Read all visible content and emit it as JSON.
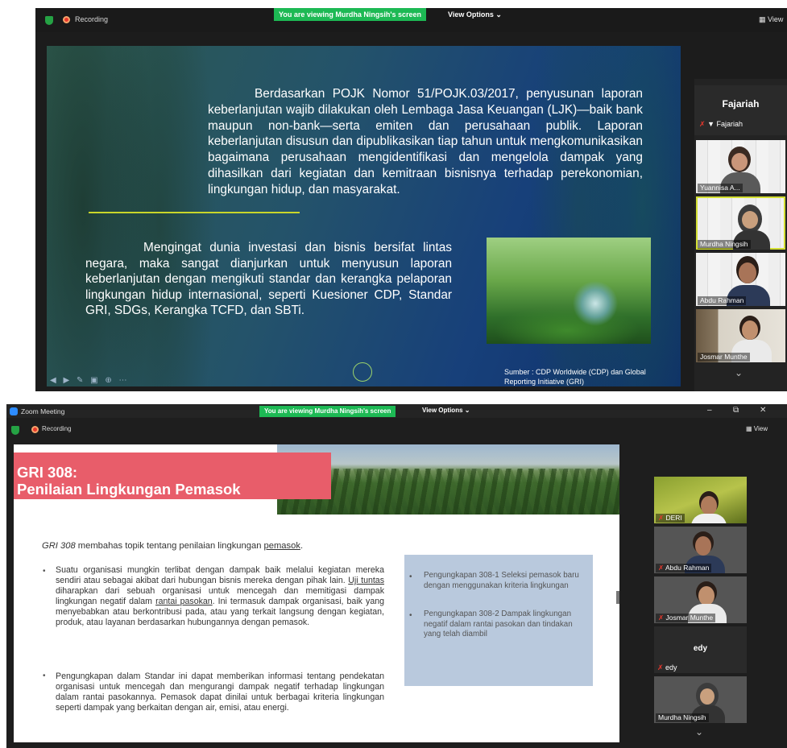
{
  "screen1": {
    "topbar": {
      "recording_label": "Recording",
      "banner": "You are viewing Murdha Ningsih's screen",
      "view_options": "View Options ⌄",
      "view_label": "View"
    },
    "slide": {
      "paragraph1": "Berdasarkan POJK Nomor 51/POJK.03/2017, penyusunan laporan keberlanjutan wajib dilakukan oleh Lembaga Jasa Keuangan (LJK)—baik bank maupun non-bank—serta emiten dan perusahaan publik. Laporan keberlanjutan disusun dan dipublikasikan tiap tahun untuk mengkomunikasikan bagaimana perusahaan mengidentifikasi dan mengelola dampak yang dihasilkan dari kegiatan dan kemitraan bisnisnya terhadap perekonomian, lingkungan hidup, dan masyarakat.",
      "paragraph2": "Mengingat dunia investasi dan bisnis bersifat lintas negara, maka sangat dianjurkan untuk menyusun laporan keberlanjutan dengan mengikuti standar dan kerangka pelaporan lingkungan hidup internasional, seperti Kuesioner CDP, Standar GRI, SDGs, Kerangka TCFD, dan SBTi.",
      "source": "Sumber : CDP Worldwide (CDP) dan Global Reporting Initiative (GRI)"
    },
    "participants_panel": {
      "active_speaker": "Fajariah",
      "speaker_tag": "Fajariah",
      "participants": [
        "Yuannisa A...",
        "Murdha Ningsih",
        "Abdu Rahman",
        "Josmar Munthe"
      ]
    }
  },
  "screen2": {
    "window_title": "Zoom Meeting",
    "topbar": {
      "recording_label": "Recording",
      "banner": "You are viewing Murdha Ningsih's screen",
      "view_options": "View Options ⌄",
      "view_label": "View"
    },
    "window_controls": {
      "minimize": "–",
      "maximize": "⧉",
      "close": "✕"
    },
    "slide": {
      "title_line1": "GRI 308:",
      "title_line2": "Penilaian Lingkungan Pemasok",
      "intro_em": "GRI 308",
      "intro_rest": " membahas topik tentang penilaian lingkungan ",
      "intro_link": "pemasok",
      "intro_end": ".",
      "bullet1_a": "Suatu organisasi mungkin terlibat dengan dampak baik melalui kegiatan mereka sendiri atau sebagai akibat dari hubungan bisnis mereka dengan pihak lain. ",
      "bullet1_u1": "Uji tuntas ",
      "bullet1_b": "diharapkan dari sebuah organisasi untuk mencegah dan memitigasi dampak lingkungan negatif dalam ",
      "bullet1_u2": "rantai pasokan",
      "bullet1_c": ". Ini termasuk dampak organisasi, baik yang menyebabkan atau berkontribusi pada, atau yang terkait langsung dengan kegiatan, produk, atau layanan berdasarkan hubungannya dengan pemasok.",
      "bullet2": "Pengungkapan dalam Standar ini dapat memberikan informasi tentang pendekatan organisasi untuk mencegah dan mengurangi dampak negatif terhadap lingkungan dalam rantai pasokannya. Pemasok dapat dinilai untuk berbagai kriteria lingkungan seperti dampak yang berkaitan dengan air, emisi, atau energi.",
      "box_item1": "Pengungkapan 308-1 Seleksi pemasok baru dengan menggunakan kriteria lingkungan",
      "box_item2": "Pengungkapan 308-2 Dampak lingkungan negatif dalam rantai pasokan dan tindakan yang telah diambil"
    },
    "participants_panel": {
      "participants": [
        "DERI",
        "Abdu Rahman",
        "Josmar Munthe",
        "edy",
        "Murdha Ningsih"
      ],
      "active_speaker": "edy"
    }
  }
}
